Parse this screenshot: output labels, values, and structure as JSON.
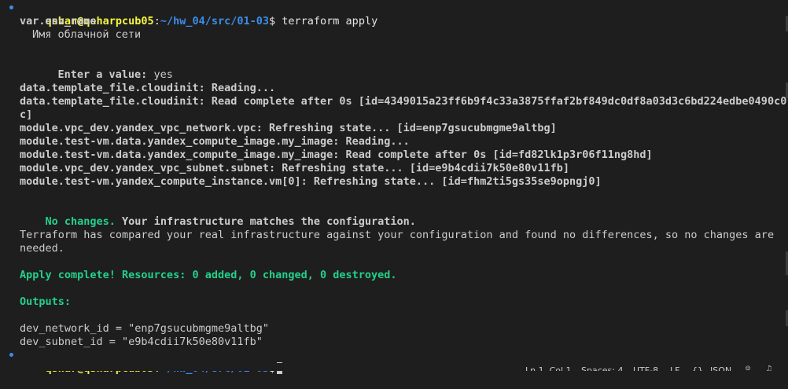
{
  "prompt": {
    "user_host": "qshar@qsharpcub05",
    "path": "~/hw_04/src/01-03",
    "symbol": "$",
    "command": "terraform apply"
  },
  "variable": {
    "name": "var.env_name",
    "description": "Имя облачной сети",
    "enter_label": "Enter a value:",
    "entered_value": "yes"
  },
  "log": [
    "data.template_file.cloudinit: Reading...",
    "data.template_file.cloudinit: Read complete after 0s [id=4349015a23ff6b9f4c33a3875ffaf2bf849dc0df8a03d3c6bd224edbe0490c0",
    "c]",
    "module.vpc_dev.yandex_vpc_network.vpc: Refreshing state... [id=enp7gsucubmgme9altbg]",
    "module.test-vm.data.yandex_compute_image.my_image: Reading...",
    "module.test-vm.data.yandex_compute_image.my_image: Read complete after 0s [id=fd82lk1p3r06f11ng8hd]",
    "module.vpc_dev.yandex_vpc_subnet.subnet: Refreshing state... [id=e9b4cdii7k50e80v11fb]",
    "module.test-vm.yandex_compute_instance.vm[0]: Refreshing state... [id=fhm2ti5gs35se9opngj0]"
  ],
  "no_changes": {
    "green": "No changes.",
    "rest": " Your infrastructure matches the configuration."
  },
  "compared": {
    "line1": "Terraform has compared your real infrastructure against your configuration and found no differences, so no changes are",
    "line2": "needed."
  },
  "apply_complete": "Apply complete! Resources: 0 added, 0 changed, 0 destroyed.",
  "outputs": {
    "heading": "Outputs:",
    "items": [
      "dev_network_id = \"enp7gsucubmgme9altbg\"",
      "dev_subnet_id = \"e9b4cdii7k50e80v11fb\""
    ]
  },
  "statusbar": {
    "position": "Ln 1, Col 1",
    "spaces": "Spaces: 4",
    "encoding": "UTF-8",
    "eol": "LF",
    "braces": "{}",
    "language": "JSON"
  },
  "colors": {
    "background": "#1e1e1e",
    "text": "#cccccc",
    "green": "#23d18b",
    "yellow": "#f5f543",
    "blue": "#3b8eea"
  }
}
